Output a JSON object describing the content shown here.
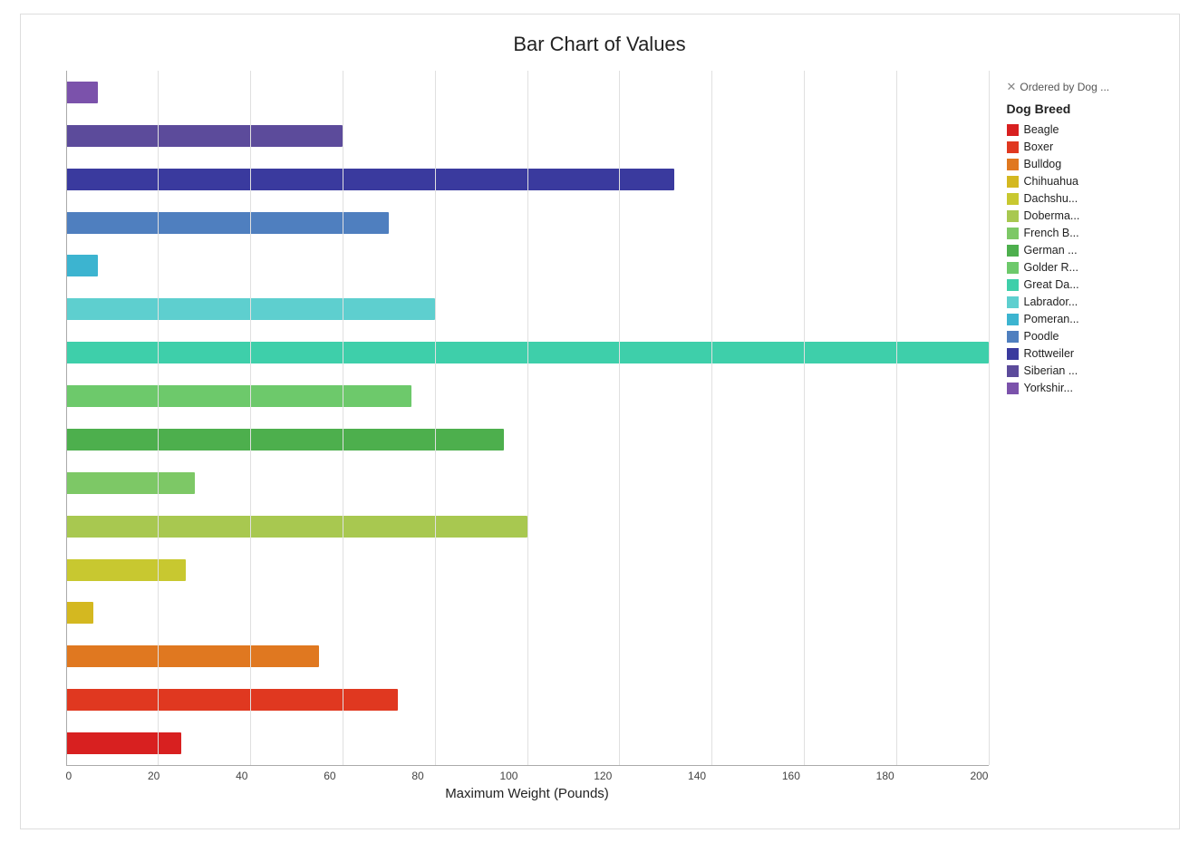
{
  "chart": {
    "title": "Bar Chart of Values",
    "x_axis_label": "Maximum Weight (Pounds)",
    "filter_label": "Ordered by Dog ...",
    "legend_title": "Dog Breed",
    "x_ticks": [
      "0",
      "20",
      "40",
      "60",
      "80",
      "100",
      "120",
      "140",
      "160",
      "180",
      "200"
    ],
    "max_value": 200,
    "bars": [
      {
        "label": "Yorkshir...",
        "color": "#7B52AB",
        "value": 7
      },
      {
        "label": "Siberian ...",
        "color": "#5C4B9B",
        "value": 60
      },
      {
        "label": "Rottweiler",
        "color": "#3A3A9E",
        "value": 132
      },
      {
        "label": "Poodle",
        "color": "#4F7FBF",
        "value": 70
      },
      {
        "label": "Pomeran...",
        "color": "#3CB4D0",
        "value": 7
      },
      {
        "label": "Labrador...",
        "color": "#5ECFCF",
        "value": 80
      },
      {
        "label": "Great Da...",
        "color": "#3ECFAA",
        "value": 200
      },
      {
        "label": "Golder R...",
        "color": "#6DC96B",
        "value": 75
      },
      {
        "label": "German ...",
        "color": "#4DAF4D",
        "value": 95
      },
      {
        "label": "French B...",
        "color": "#7DC866",
        "value": 28
      },
      {
        "label": "Doberma...",
        "color": "#A8C850",
        "value": 100
      },
      {
        "label": "Dachshu...",
        "color": "#C8C830",
        "value": 26
      },
      {
        "label": "Chihuahua",
        "color": "#D4B820",
        "value": 6
      },
      {
        "label": "Bulldog",
        "color": "#E07820",
        "value": 55
      },
      {
        "label": "Boxer",
        "color": "#E03820",
        "value": 72
      },
      {
        "label": "Beagle",
        "color": "#D82020",
        "value": 25
      }
    ],
    "legend_items": [
      {
        "label": "Beagle",
        "color": "#D82020"
      },
      {
        "label": "Boxer",
        "color": "#E03820"
      },
      {
        "label": "Bulldog",
        "color": "#E07820"
      },
      {
        "label": "Chihuahua",
        "color": "#D4B820"
      },
      {
        "label": "Dachshu...",
        "color": "#C8C830"
      },
      {
        "label": "Doberma...",
        "color": "#A8C850"
      },
      {
        "label": "French B...",
        "color": "#7DC866"
      },
      {
        "label": "German ...",
        "color": "#4DAF4D"
      },
      {
        "label": "Golder R...",
        "color": "#6DC96B"
      },
      {
        "label": "Great Da...",
        "color": "#3ECFAA"
      },
      {
        "label": "Labrador...",
        "color": "#5ECFCF"
      },
      {
        "label": "Pomeran...",
        "color": "#3CB4D0"
      },
      {
        "label": "Poodle",
        "color": "#4F7FBF"
      },
      {
        "label": "Rottweiler",
        "color": "#3A3A9E"
      },
      {
        "label": "Siberian ...",
        "color": "#5C4B9B"
      },
      {
        "label": "Yorkshir...",
        "color": "#7B52AB"
      }
    ]
  }
}
